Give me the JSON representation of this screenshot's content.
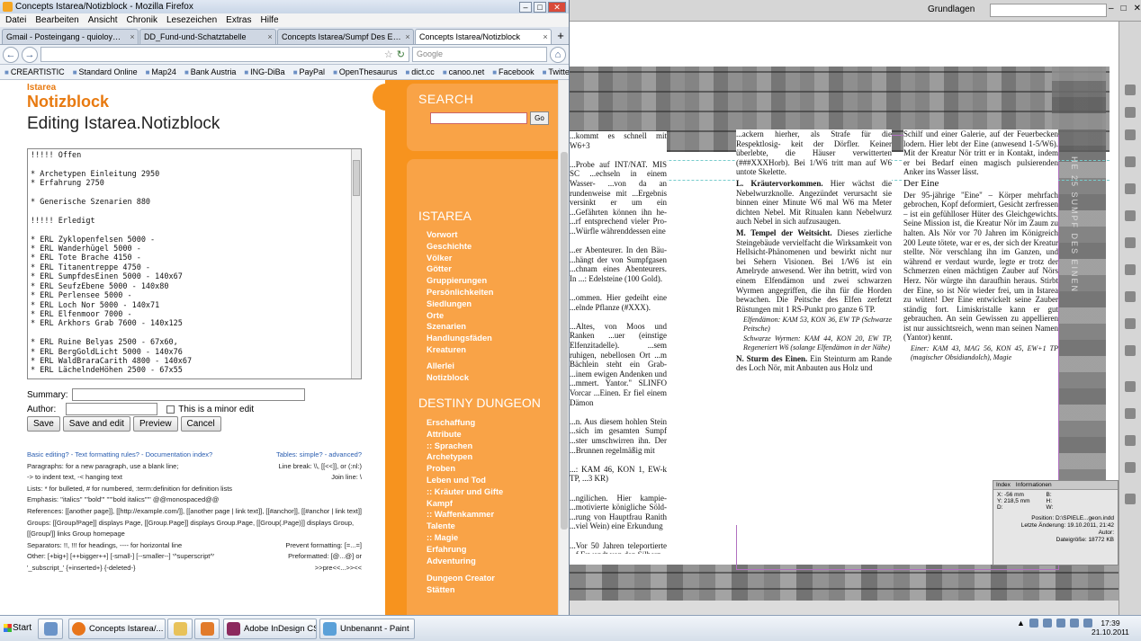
{
  "firefox": {
    "window_title": "Concepts Istarea/Notizblock - Mozilla Firefox",
    "menu": [
      "Datei",
      "Bearbeiten",
      "Ansicht",
      "Chronik",
      "Lesezeichen",
      "Extras",
      "Hilfe"
    ],
    "tabs": [
      {
        "label": "Gmail - Posteingang - quioloy@gmail...."
      },
      {
        "label": "DD_Fund-und-Schatztabelle"
      },
      {
        "label": "Concepts Istarea/Sumpf Des Einen"
      },
      {
        "label": "Concepts Istarea/Notizblock"
      }
    ],
    "new_tab": "+",
    "search_placeholder": "Google",
    "bookmarks": [
      "CREARTISTIC",
      "Standard Online",
      "Map24",
      "Bank Austria",
      "ING-DiBa",
      "PayPal",
      "OpenThesaurus",
      "dict.cc",
      "canoo.net",
      "Facebook",
      "Twitter"
    ]
  },
  "page": {
    "site": "Istarea",
    "title": "Notizblock",
    "editing": "Editing Istarea.Notizblock",
    "editor_text": "!!!!! Offen\n\n* Archetypen Einleitung 2950\n* Erfahrung 2750\n\n* Generische Szenarien 880\n\n!!!!! Erledigt\n\n* ERL Zyklopenfelsen 5000 -\n* ERL Wanderhügel 5000 -\n* ERL Tote Brache 4150 -\n* ERL Titanentreppe 4750 -\n* ERL SumpfdesEinen 5000 - 140x67\n* ERL SeufzEbene 5000 - 140x80\n* ERL Perlensee 5000 -\n* ERL Loch Nor 5000 - 140x71\n* ERL Elfenmoor 7000 -\n* ERL Arkhors Grab 7600 - 140x125\n\n* ERL Ruine Belyas 2500 - 67x60,\n* ERL BergGoldLicht 5000 - 140x76\n* ERL WaldBraraCarith 4800 - 140x67\n* ERL LächelndeHöhen 2500 - 67x55",
    "summary_label": "Summary:",
    "author_label": "Author:",
    "minor_edit": "This is a minor edit",
    "buttons": {
      "save": "Save",
      "save_edit": "Save and edit",
      "preview": "Preview",
      "cancel": "Cancel"
    },
    "help": {
      "line1_left": "Basic editing? - Text formatting rules? - Documentation index?",
      "line1_right": "Tables: simple? - advanced?",
      "line2_left": "Paragraphs: for a new paragraph, use a blank line;",
      "line2_right": "Line break: \\\\, [[<<]], or (:nl:)",
      "line3_left": "-> to indent text, -< hanging text",
      "line3_right": "Join line: \\",
      "line4": "Lists: * for bulleted, # for numbered, :term:definition for definition lists",
      "line5": "Emphasis: ''italics'' '''bold''' '''''bold italics''''' @@monospaced@@",
      "line6": "References: [[another page]], [[http://example.com/]], [[another page | link text]], [[#anchor]], [[#anchor | link text]]",
      "line7": "Groups: [[Group/Page]] displays Page, [[Group.Page]] displays Group.Page, [[Group(.Page)]] displays Group, [[Group/]] links Group homepage",
      "line8_left": "Separators: !!, !!! for headings, ---- for horizontal line",
      "line8_right": "Prevent formatting: [=...=]",
      "line9_left": "Other: [+big+] [++bigger++] [-small-] [--smaller--] '^superscript^'",
      "line9_right": "Preformatted: [@...@] or",
      "line10_left": "'_subscript_' {+inserted+} {-deleted-}",
      "line10_right": ">>pre<<...>><<"
    },
    "search_label": "SEARCH",
    "go": "Go",
    "istarea_head": "ISTAREA",
    "istarea_links": [
      "Vorwort",
      "Geschichte",
      "Völker",
      "Götter",
      "Gruppierungen",
      "Persönlichkeiten",
      "Siedlungen",
      "Orte",
      "Szenarien",
      "Handlungsfäden",
      "Kreaturen"
    ],
    "istarea_links2": [
      "Allerlei",
      "Notizblock"
    ],
    "dd_head": "DESTINY DUNGEON",
    "dd_links": [
      "Erschaffung",
      "Attribute",
      ":: Sprachen",
      "Archetypen",
      "Proben",
      "Leben und Tod",
      ":: Kräuter und Gifte",
      "Kampf",
      ":: Waffenkammer",
      "Talente",
      ":: Magie",
      "Erfahrung",
      "Adventuring"
    ],
    "dd_links2": [
      "Dungeon Creator",
      "Stätten"
    ]
  },
  "indesign": {
    "workspace": "Grundlagen",
    "vertical_text": "HE 25 SUMPF DES EINEN",
    "col1": "...kommt es schnell mit W6+3\n\n...Probe auf INT/NAT. MIS SC ...echseln in einem Wasser- ...von da an rundenweise mit ...Ergebnis versinkt er um ein ...Gefährten können ihn he- ...rf entsprechend vieler Pro- ...Würfle währenddessen eine\n\n...er Abenteurer. In den Bäu- ...hängt der von Sumpfgasen ...chnam eines Abenteurers. In ...: Edelsteine (100 Gold).\n\n...ommen. Hier gedeiht eine ...elnde Pflanze (#XXX).\n\n...Altes, von Moos und Ranken ...uer (einstige Elfenzitadelle). ...sem ruhigen, nebellosen Ort ...m Bächlein steht ein Grab- ...inem ewigen Andenken und ...mmert. Yantor.\" SLINFO Vorcar ...Einen. Er fiel einem Dämon\n\n...n. Aus diesem hohlen Stein ...sich im gesamten Sumpf ...ster umschwirren ihn. Der ...Brunnen regelmäßig mit\n\n...: KAM 46, KON 1, EW-k TP, ...3 KR)\n\n...ngilichen. Hier kampie- ...motivierte königliche Söld- ...rung von Hauptfrau Ranith ...viel Wein) eine Erkundung\n\n...Vor 50 Jahren teleportierte ...f Erwendt von den Silberz-",
    "col2_intro": "...ackern hierher, als Strafe für die Respektlosig- keit der Dörfler. Keiner überlebte, die Häuser verwitterten (###XXXHorb). Bei 1/W6 tritt man auf W6 untote Skelette.",
    "col2_l_head": "L. Kräutervorkommen.",
    "col2_l": "Hier wächst die Nebelwurzknolle. Angezündet verursacht sie binnen einer Minute W6 mal W6 ma Meter dichten Nebel. Mit Ritualen kann Nebelwurz auch Nebel in sich aufzusaugen.",
    "col2_m_head": "M. Tempel der Weitsicht.",
    "col2_m": "Dieses zierliche Steingebäude vervielfacht die Wirksamkeit von Hellsicht-Phänomenen und bewirkt nicht nur bei Sehern Visionen. Bei 1/W6 ist ein Amelryde anwesend. Wer ihn betritt, wird von einem Elfendämon und zwei schwarzen Wyrmen angegriffen, die ihn für die Horden bewachen. Die Peitsche des Elfen zerfetzt Rüstungen mit 1 RS-Punkt pro ganze 6 TP.",
    "col2_stat1": "Elfendämon: KAM 53, KON 36, EW TP (Schwarze Peitsche)",
    "col2_stat2": "Schwarze Wyrmen: KAM 44, KON 20, EW TP, Regeneriert W6 (solange Elfendämon in der Nähe)",
    "col2_n_head": "N. Sturm des Einen.",
    "col2_n": "Ein Steinturm am Rande des Loch Nör, mit Anbauten aus Holz und",
    "col3_intro": "Schilf und einer Galerie, auf der Feuerbecken lodern. Hier lebt der Eine (anwesend 1-5/W6). Mit der Kreatur Nör tritt er in Kontakt, indem er bei Bedarf einen magisch pulsierenden Anker ins Wasser lässt.",
    "col3_head": "Der Eine",
    "col3_body": "Der 95-jährige \"Eine\" – Körper mehrfach gebrochen, Kopf deformiert, Gesicht zerfressen – ist ein gefühlloser Hüter des Gleichgewichts. Seine Mission ist, die Kreatur Nör im Zaum zu halten. Als Nör vor 70 Jahren im Königreich 200 Leute tötete, war er es, der sich der Kreatur stellte. Nör verschlang ihn im Ganzen, und während er verdaut wurde, legte er trotz der Schmerzen einen mächtigen Zauber auf Nörs Herz. Nör würgte ihn daraufhin heraus. Stirbt der Eine, so ist Nör wieder frei, um in Istarea zu wüten! Der Eine entwickelt seine Zauber ständig fort. Limiskristalle kann er gut gebrauchen. An sein Gewissen zu appellieren ist nur aussichtsreich, wenn man seinen Namen (Yantor) kennt.",
    "col3_stat": "Einer: KAM 43, MAG 56, KON 45, EW+1 TP (magischer Obsidiandolch), Magie",
    "info": {
      "tabs": [
        "Index",
        "Informationen"
      ],
      "x": "X: -56 mm",
      "y": "Y: 218,5 mm",
      "d": "D:",
      "b": "B:",
      "h": "H:",
      "w": "W:",
      "position": "Position: D:\\SPIELE...geon.indd",
      "letzte": "Letzte Änderung: 19.10.2011, 21:42",
      "autor": "Autor:",
      "size": "Dateigröße: 18772 KB"
    }
  },
  "taskbar": {
    "start": "Start",
    "items": [
      "Concepts Istarea/...",
      "Adobe InDesign CS4 ...",
      "Unbenannt - Paint"
    ],
    "time": "17:39",
    "date": "21.10.2011"
  }
}
